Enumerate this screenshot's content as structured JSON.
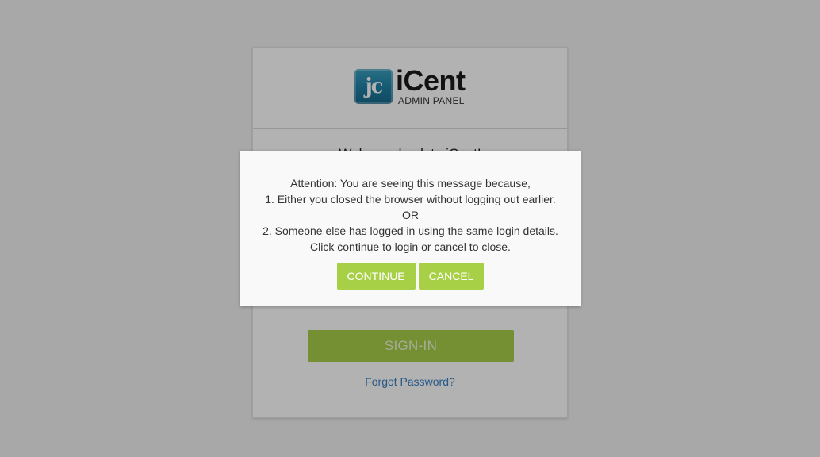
{
  "brand": {
    "logo_mark": "jc",
    "name": "iCent",
    "subtitle": "ADMIN PANEL"
  },
  "login": {
    "welcome_text": "Welcome back to iCent!",
    "signin_label": "SIGN-IN",
    "forgot_password_label": "Forgot Password?"
  },
  "dialog": {
    "lines": [
      "Attention: You are seeing this message because,",
      "1. Either you closed the browser without logging out earlier.",
      "OR",
      "2. Someone else has logged in using the same login details.",
      "Click continue to login or cancel to close."
    ],
    "continue_label": "CONTINUE",
    "cancel_label": "CANCEL"
  },
  "colors": {
    "accent_green": "#a8d047",
    "link_blue": "#3a7fc1",
    "logo_blue": "#1f7fa3"
  }
}
